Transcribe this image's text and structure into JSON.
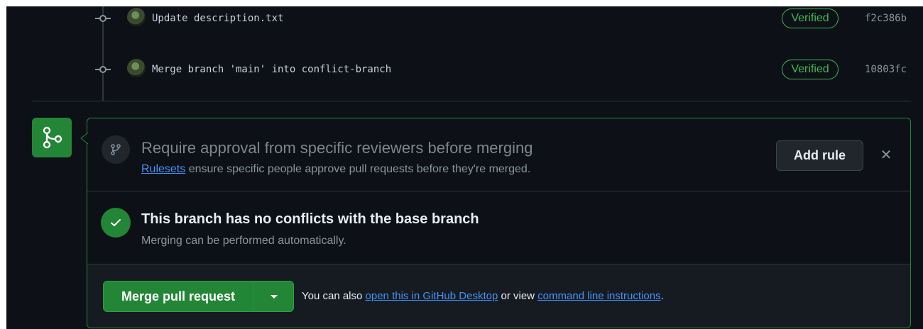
{
  "commits": [
    {
      "message": "Update description.txt",
      "badge": "Verified",
      "sha": "f2c386b"
    },
    {
      "message": "Merge branch 'main' into conflict-branch",
      "badge": "Verified",
      "sha": "10803fc"
    }
  ],
  "ruleset_notice": {
    "title": "Require approval from specific reviewers before merging",
    "link_text": "Rulesets",
    "text": " ensure specific people approve pull requests before they're merged.",
    "add_rule_label": "Add rule",
    "close_glyph": "✕"
  },
  "merge_status": {
    "title": "This branch has no conflicts with the base branch",
    "subtitle": "Merging can be performed automatically."
  },
  "merge_actions": {
    "merge_label": "Merge pull request",
    "also_prefix": "You can also ",
    "desktop_link": "open this in GitHub Desktop",
    "middle": " or view ",
    "cli_link": "command line instructions",
    "suffix": "."
  },
  "colors": {
    "background": "#0d1117",
    "accent_green": "#238636",
    "verified_green": "#3fb950",
    "link_blue": "#4493f8"
  },
  "icons": [
    "commit-node-icon",
    "avatar",
    "git-merge-icon",
    "git-branch-icon",
    "close-icon",
    "check-icon",
    "caret-down-icon"
  ]
}
